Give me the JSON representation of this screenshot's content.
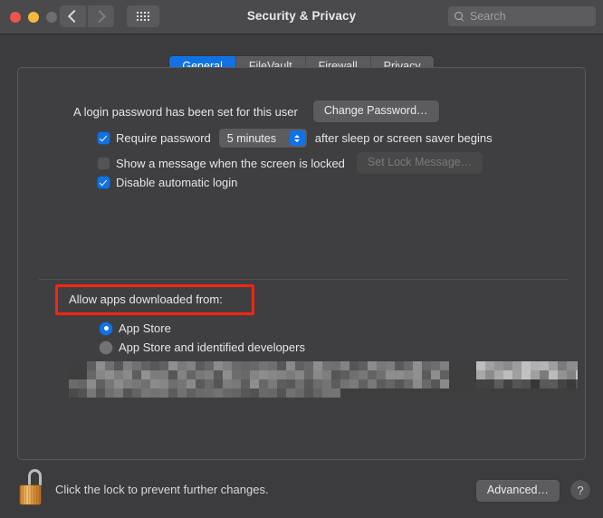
{
  "window": {
    "title": "Security & Privacy",
    "traffic_lights": [
      "close",
      "minimize",
      "zoom"
    ],
    "nav": {
      "back_icon": "chevron-left-icon",
      "forward_icon": "chevron-right-icon",
      "grid_icon": "show-all-grid-icon"
    }
  },
  "search": {
    "placeholder": "Search",
    "value": "",
    "icon": "search-icon"
  },
  "tabs": [
    {
      "label": "General",
      "active": true
    },
    {
      "label": "FileVault",
      "active": false
    },
    {
      "label": "Firewall",
      "active": false
    },
    {
      "label": "Privacy",
      "active": false
    }
  ],
  "general": {
    "login_password_text": "A login password has been set for this user",
    "change_password_button": "Change Password…",
    "require_password": {
      "checked": true,
      "label_before": "Require password",
      "interval_value": "5 minutes",
      "label_after": "after sleep or screen saver begins"
    },
    "show_message": {
      "checked": false,
      "label": "Show a message when the screen is locked",
      "button": "Set Lock Message…",
      "button_disabled": true
    },
    "disable_auto_login": {
      "checked": true,
      "label": "Disable automatic login"
    },
    "allow_apps": {
      "label": "Allow apps downloaded from:",
      "highlighted": true,
      "highlight_color": "#fb2412",
      "options": [
        {
          "label": "App Store",
          "selected": true
        },
        {
          "label": "App Store and identified developers",
          "selected": false
        }
      ]
    },
    "redacted_note": ""
  },
  "footer": {
    "lock_icon": "unlocked-padlock-icon",
    "lock_text": "Click the lock to prevent further changes.",
    "advanced_button": "Advanced…",
    "help_button": "?"
  },
  "colors": {
    "accent_blue": "#1272e5",
    "highlight_red": "#fb2412",
    "window_bg": "#3c3c3e",
    "titlebar_bg": "#4a4a4c",
    "panel_bg": "#3f3f41"
  }
}
